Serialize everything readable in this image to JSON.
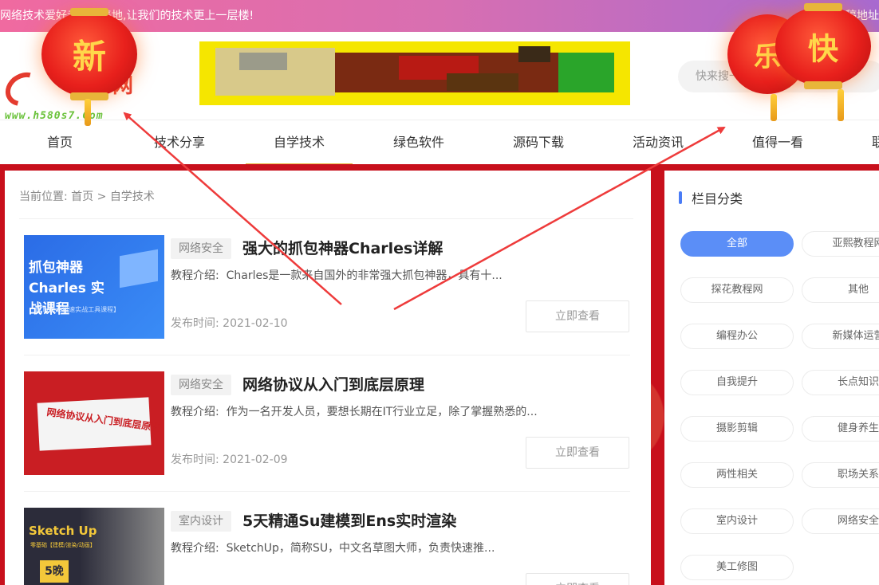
{
  "topbar": {
    "left_text": "网络技术爱好者的聚集地,让我们的技术更上一层楼!",
    "right_text": "投稿地址"
  },
  "logo": {
    "url_text": "www.h580s7.Com",
    "wang": "网"
  },
  "search": {
    "placeholder": "快来搜一搜吧"
  },
  "nav": {
    "items": [
      "首页",
      "技术分享",
      "自学技术",
      "绿色软件",
      "源码下载",
      "活动资讯",
      "值得一看",
      "联"
    ],
    "active_index": 2,
    "accent_color": "#e8b53a"
  },
  "breadcrumb": {
    "label": "当前位置:",
    "home": "首页",
    "sep": ">",
    "current": "自学技术"
  },
  "posts": [
    {
      "tag": "网络安全",
      "title": "强大的抓包神器Charles详解",
      "desc_label": "教程介绍:",
      "desc": "Charles是一款来自国外的非常强大抓包神器，具有十...",
      "date_label": "发布时间:",
      "date": "2021-02-10",
      "button": "立即查看",
      "thumb_title": "抓包神器Charles 实战课程",
      "thumb_sub": "【Charles极速实战工具课程】"
    },
    {
      "tag": "网络安全",
      "title": "网络协议从入门到底层原理",
      "desc_label": "教程介绍:",
      "desc": "作为一名开发人员，要想长期在IT行业立足，除了掌握熟悉的...",
      "date_label": "发布时间:",
      "date": "2021-02-09",
      "button": "立即查看",
      "thumb_title": "网络协议从入门到底层原理"
    },
    {
      "tag": "室内设计",
      "title": "5天精通Su建模到Ens实时渲染",
      "desc_label": "教程介绍:",
      "desc": "SketchUp，简称SU，中文名草图大师，负责快速推...",
      "date_label": "发布时间:",
      "date": "",
      "button": "立即查看",
      "thumb_title": "Sketch Up",
      "thumb_sub": "零基础【建模/渲染/动画】",
      "thumb_badge": "5晚"
    }
  ],
  "sidebar": {
    "heading": "栏目分类",
    "accent_color": "#5b8ef7",
    "categories": [
      "全部",
      "亚熙教程网",
      "探花教程网",
      "其他",
      "编程办公",
      "新媒体运营",
      "自我提升",
      "长点知识",
      "摄影剪辑",
      "健身养生",
      "两性相关",
      "职场关系",
      "室内设计",
      "网络安全",
      "美工修图"
    ],
    "active_index": 0
  },
  "lanterns": {
    "left": "新",
    "right_back": "乐",
    "right_front": "快"
  }
}
